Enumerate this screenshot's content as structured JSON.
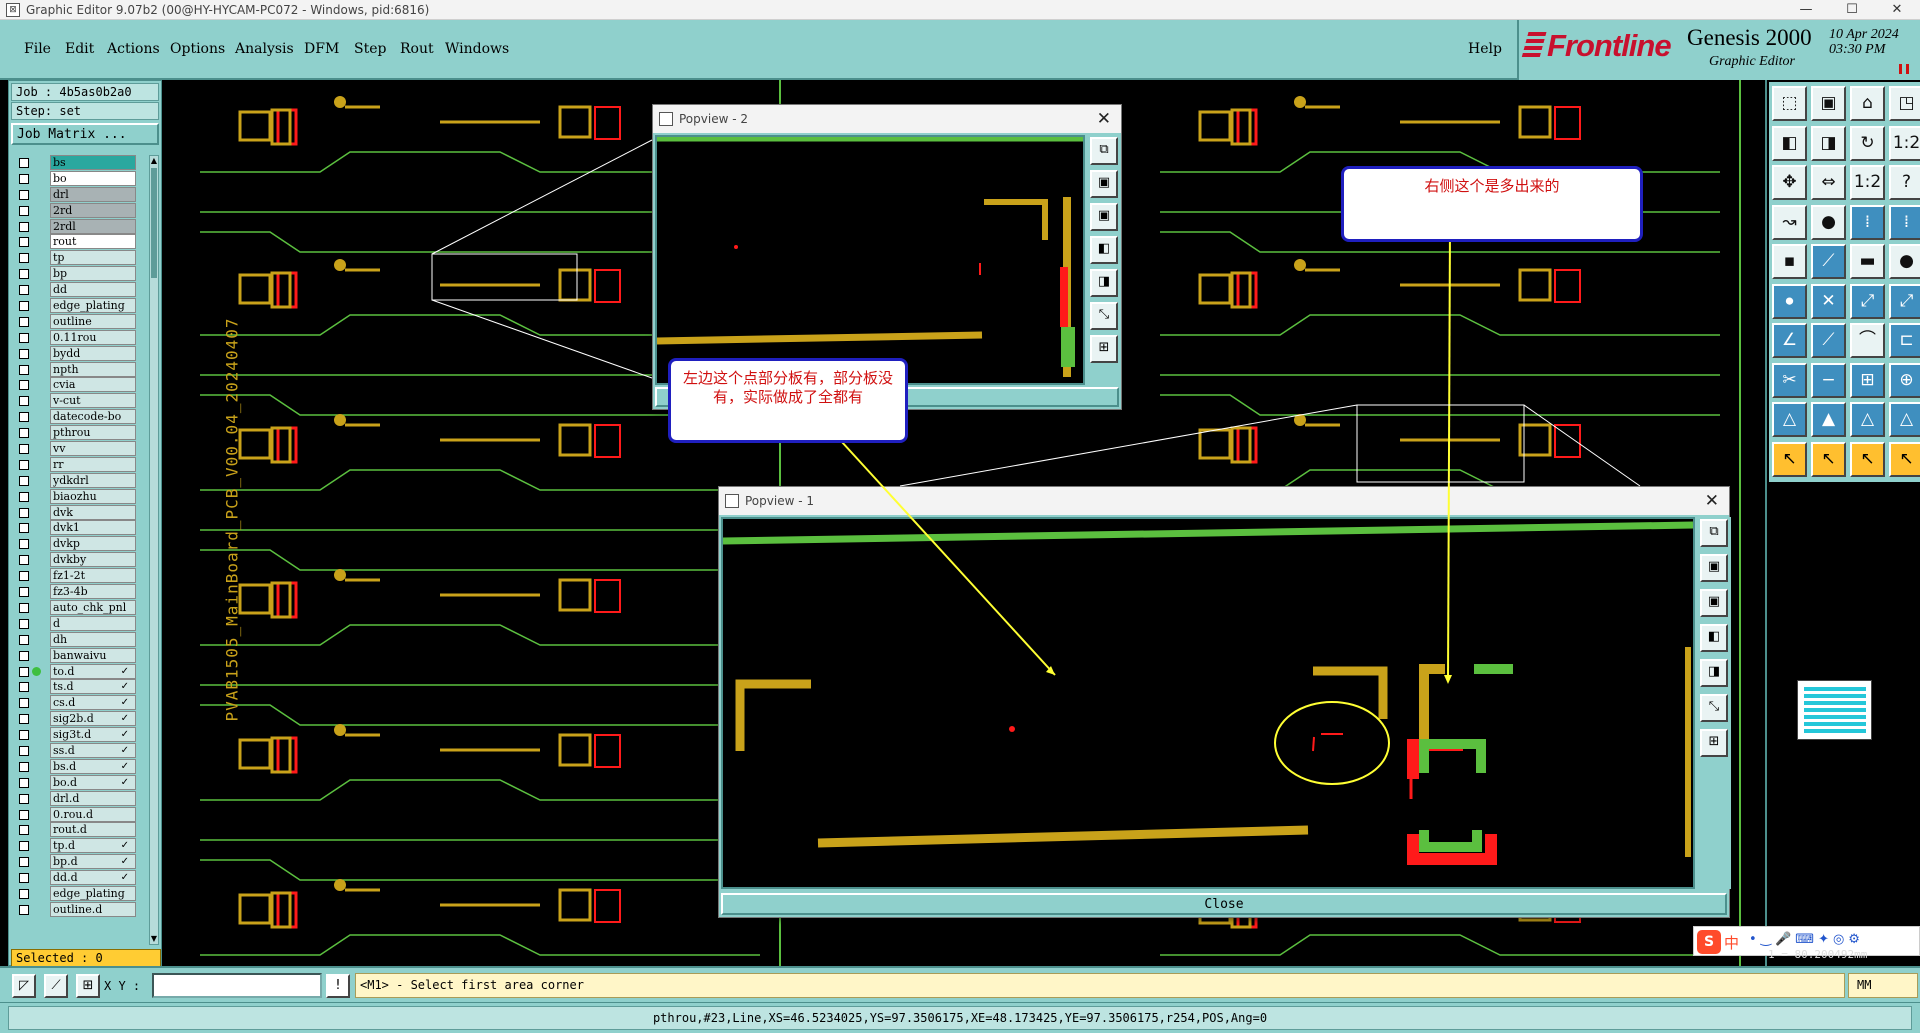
{
  "window": {
    "title": "Graphic Editor 9.07b2 (00@HY-HYCAM-PC072 - Windows, pid:6816)",
    "minimize": "—",
    "maximize": "☐",
    "close": "✕"
  },
  "menu": [
    "File",
    "Edit",
    "Actions",
    "Options",
    "Analysis",
    "DFM",
    "Step",
    "Rout",
    "Windows"
  ],
  "help": "Help",
  "logo": {
    "brand": "Frontline",
    "product": "Genesis 2000",
    "subtitle": "Graphic Editor",
    "date": "10 Apr 2024\n03:30 PM"
  },
  "job": {
    "job_label": "Job : 4b5as0b2a0",
    "step_label": "Step: set",
    "matrix_button": "Job Matrix ..."
  },
  "layers": [
    {
      "name": "bs",
      "style": "teal",
      "checked": false,
      "active": false,
      "mark": ""
    },
    {
      "name": "bo",
      "style": "white",
      "checked": false,
      "active": false,
      "mark": ""
    },
    {
      "name": "drl",
      "style": "gray",
      "checked": false,
      "active": false,
      "mark": ""
    },
    {
      "name": "2rd",
      "style": "gray",
      "checked": false,
      "active": false,
      "mark": ""
    },
    {
      "name": "2rdl",
      "style": "gray",
      "checked": false,
      "active": false,
      "mark": ""
    },
    {
      "name": "rout",
      "style": "white",
      "checked": false,
      "active": false,
      "mark": ""
    },
    {
      "name": "tp",
      "style": "",
      "checked": false,
      "active": false,
      "mark": ""
    },
    {
      "name": "bp",
      "style": "",
      "checked": false,
      "active": false,
      "mark": ""
    },
    {
      "name": "dd",
      "style": "",
      "checked": false,
      "active": false,
      "mark": ""
    },
    {
      "name": "edge_plating",
      "style": "",
      "checked": false,
      "active": false,
      "mark": ""
    },
    {
      "name": "outline",
      "style": "",
      "checked": false,
      "active": false,
      "mark": ""
    },
    {
      "name": "0.11rou",
      "style": "",
      "checked": false,
      "active": false,
      "mark": ""
    },
    {
      "name": "bydd",
      "style": "",
      "checked": false,
      "active": false,
      "mark": ""
    },
    {
      "name": "npth",
      "style": "",
      "checked": false,
      "active": false,
      "mark": ""
    },
    {
      "name": "cvia",
      "style": "",
      "checked": false,
      "active": false,
      "mark": ""
    },
    {
      "name": "v-cut",
      "style": "",
      "checked": false,
      "active": false,
      "mark": ""
    },
    {
      "name": "datecode-bo",
      "style": "",
      "checked": false,
      "active": false,
      "mark": ""
    },
    {
      "name": "pthrou",
      "style": "",
      "checked": false,
      "active": false,
      "mark": ""
    },
    {
      "name": "vv",
      "style": "",
      "checked": false,
      "active": false,
      "mark": ""
    },
    {
      "name": "rr",
      "style": "",
      "checked": false,
      "active": false,
      "mark": ""
    },
    {
      "name": "ydkdrl",
      "style": "",
      "checked": false,
      "active": false,
      "mark": ""
    },
    {
      "name": "biaozhu",
      "style": "",
      "checked": false,
      "active": false,
      "mark": ""
    },
    {
      "name": "dvk",
      "style": "",
      "checked": false,
      "active": false,
      "mark": ""
    },
    {
      "name": "dvk1",
      "style": "",
      "checked": false,
      "active": false,
      "mark": ""
    },
    {
      "name": "dvkp",
      "style": "",
      "checked": false,
      "active": false,
      "mark": ""
    },
    {
      "name": "dvkby",
      "style": "",
      "checked": false,
      "active": false,
      "mark": ""
    },
    {
      "name": "fz1-2t",
      "style": "",
      "checked": false,
      "active": false,
      "mark": ""
    },
    {
      "name": "fz3-4b",
      "style": "",
      "checked": false,
      "active": false,
      "mark": ""
    },
    {
      "name": "auto_chk_pnl",
      "style": "",
      "checked": false,
      "active": false,
      "mark": ""
    },
    {
      "name": "d",
      "style": "",
      "checked": false,
      "active": false,
      "mark": ""
    },
    {
      "name": "dh",
      "style": "",
      "checked": false,
      "active": false,
      "mark": ""
    },
    {
      "name": "banwaivu",
      "style": "",
      "checked": false,
      "active": false,
      "mark": ""
    },
    {
      "name": "to.d",
      "style": "",
      "checked": false,
      "active": true,
      "mark": "✓"
    },
    {
      "name": "ts.d",
      "style": "",
      "checked": false,
      "active": false,
      "mark": "✓"
    },
    {
      "name": "cs.d",
      "style": "",
      "checked": false,
      "active": false,
      "mark": "✓"
    },
    {
      "name": "sig2b.d",
      "style": "",
      "checked": false,
      "active": false,
      "mark": "✓"
    },
    {
      "name": "sig3t.d",
      "style": "",
      "checked": false,
      "active": false,
      "mark": "✓"
    },
    {
      "name": "ss.d",
      "style": "",
      "checked": false,
      "active": false,
      "mark": "✓"
    },
    {
      "name": "bs.d",
      "style": "",
      "checked": false,
      "active": false,
      "mark": "✓"
    },
    {
      "name": "bo.d",
      "style": "",
      "checked": false,
      "active": false,
      "mark": "✓"
    },
    {
      "name": "drl.d",
      "style": "",
      "checked": false,
      "active": false,
      "mark": ""
    },
    {
      "name": "0.rou.d",
      "style": "",
      "checked": false,
      "active": false,
      "mark": ""
    },
    {
      "name": "rout.d",
      "style": "",
      "checked": false,
      "active": false,
      "mark": ""
    },
    {
      "name": "tp.d",
      "style": "",
      "checked": false,
      "active": false,
      "mark": "✓"
    },
    {
      "name": "bp.d",
      "style": "",
      "checked": false,
      "active": false,
      "mark": "✓"
    },
    {
      "name": "dd.d",
      "style": "",
      "checked": false,
      "active": false,
      "mark": "✓"
    },
    {
      "name": "edge_plating",
      "style": "",
      "checked": false,
      "active": false,
      "mark": ""
    },
    {
      "name": "outline.d",
      "style": "",
      "checked": false,
      "active": false,
      "mark": ""
    }
  ],
  "selected": "Selected : 0",
  "canvas_watermark": "PVAB1505_MainBoard_PCB_V00.04_20240407",
  "popview2": {
    "title": "Popview - 2",
    "close_x": "✕"
  },
  "popview1": {
    "title": "Popview - 1",
    "close_x": "✕",
    "close_button": "Close"
  },
  "callouts": {
    "left": "左边这个点部分板有，部分板没有，实际做成了全都有",
    "right": "右侧这个是多出来的"
  },
  "bottom": {
    "xy_label": "X Y :",
    "xy_value": "",
    "prompt": "<M1> - Select first area corner",
    "units": "MM"
  },
  "status": "pthrou,#23,Line,XS=46.5234025,YS=97.3506175,XE=48.173425,YE=97.3506175,r254,POS,Ang=0",
  "ime": {
    "label": "中",
    "coords": "1 = 80.200492mm"
  },
  "colors": {
    "panel": "#8fd0cc",
    "trace_green": "#5bbf3f",
    "trace_olive": "#c9a21a",
    "pad_red": "#ff1a1a",
    "callout_border": "#1f1fbf",
    "callout_text": "#d01010"
  }
}
